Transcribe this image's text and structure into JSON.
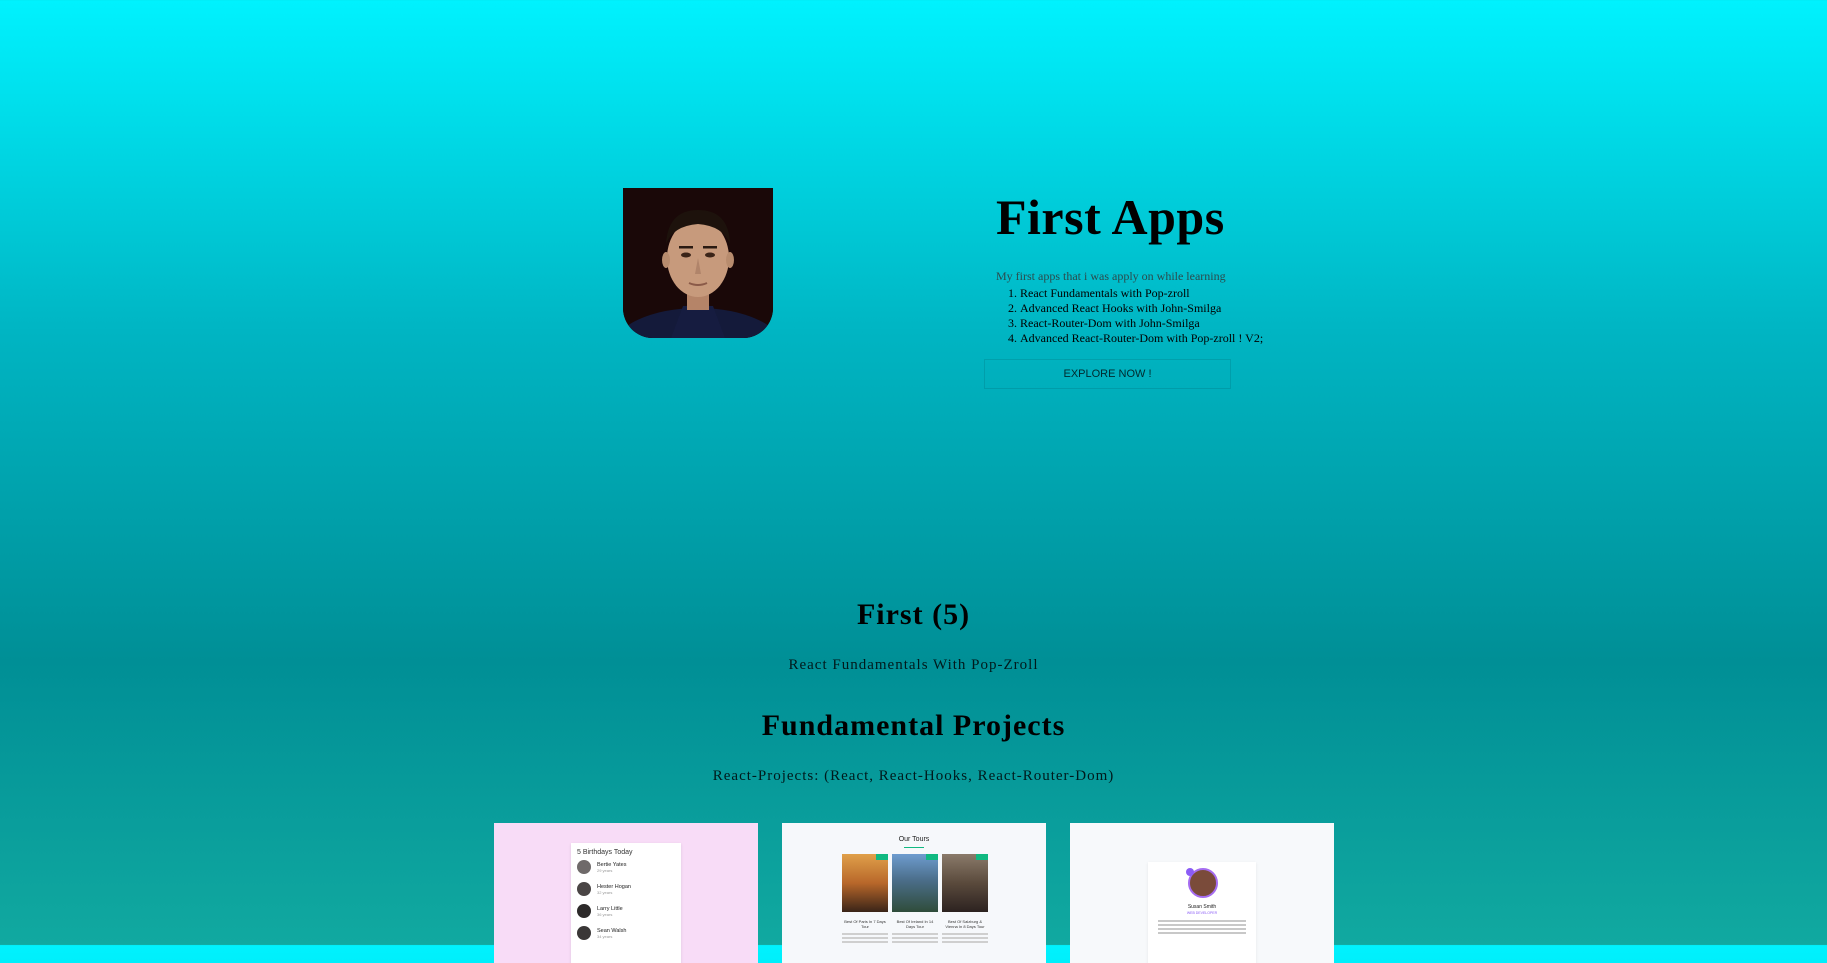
{
  "hero": {
    "title": "First Apps",
    "subtitle": "My first apps that i was apply on while learning",
    "list": [
      "React Fundamentals with Pop-zroll",
      "Advanced React Hooks with John-Smilga",
      "React-Router-Dom with John-Smilga",
      "Advanced React-Router-Dom with Pop-zroll ! V2;"
    ],
    "explore_label": "EXPLORE NOW !"
  },
  "section1": {
    "title": "First (5)",
    "subtitle": "React Fundamentals With Pop-Zroll"
  },
  "section2": {
    "title": "Fundamental Projects",
    "subtitle": "React-Projects: (React, React-Hooks, React-Router-Dom)"
  },
  "cards": {
    "birthday": {
      "title": "5 Birthdays Today",
      "people": [
        {
          "name": "Bertie Yates",
          "age": "29 years"
        },
        {
          "name": "Hester Hogan",
          "age": "32 years"
        },
        {
          "name": "Larry Little",
          "age": "36 years"
        },
        {
          "name": "Sean Walsh",
          "age": "34 years"
        }
      ]
    },
    "tours": {
      "title": "Our Tours",
      "items": [
        {
          "name": "Best Of Paris In 7 Days Tour"
        },
        {
          "name": "Best Of Ireland In 14 Days Tour"
        },
        {
          "name": "Best Of Salzburg & Vienna In 8 Days Tour"
        }
      ]
    },
    "review": {
      "name": "Susan Smith",
      "job": "WEB DEVELOPER"
    }
  }
}
